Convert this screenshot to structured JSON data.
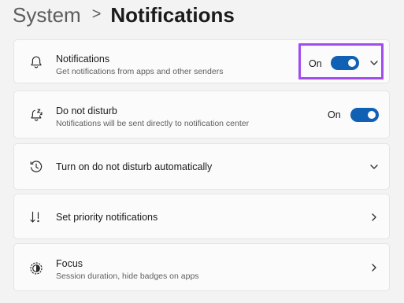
{
  "breadcrumb": {
    "parent": "System",
    "separator": ">",
    "current": "Notifications"
  },
  "settings": [
    {
      "key": "notifications",
      "icon": "bell-icon",
      "title": "Notifications",
      "subtitle": "Get notifications from apps and other senders",
      "control": "toggle-expand",
      "state_label": "On",
      "toggle_on": true
    },
    {
      "key": "do-not-disturb",
      "icon": "bell-snooze-icon",
      "title": "Do not disturb",
      "subtitle": "Notifications will be sent directly to notification center",
      "control": "toggle",
      "state_label": "On",
      "toggle_on": true
    },
    {
      "key": "dnd-automatic",
      "icon": "clock-icon",
      "title": "Turn on do not disturb automatically",
      "control": "expand"
    },
    {
      "key": "priority",
      "icon": "sort-priority-icon",
      "title": "Set priority notifications",
      "control": "navigate"
    },
    {
      "key": "focus",
      "icon": "focus-icon",
      "title": "Focus",
      "subtitle": "Session duration, hide badges on apps",
      "control": "navigate"
    }
  ],
  "colors": {
    "accent": "#1060b4",
    "highlight": "#a14bf0",
    "background": "#f3f3f3",
    "card": "#fbfbfb"
  }
}
